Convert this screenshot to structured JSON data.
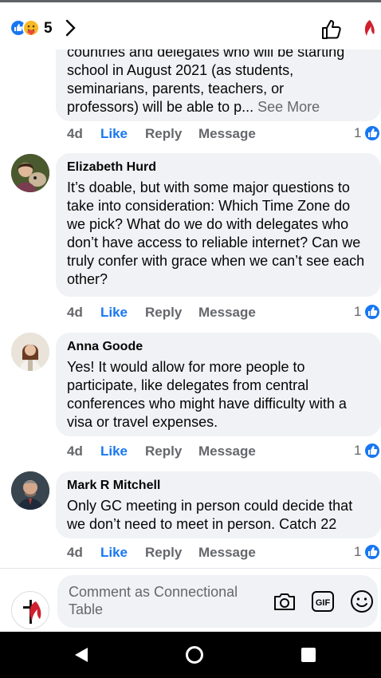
{
  "header": {
    "reaction_count": "5",
    "reaction_icons": [
      "like-icon",
      "care-icon"
    ],
    "chevron": "chevron-right-icon",
    "like_button_icon": "thumbs-up-outline-icon",
    "page_logo": "cross-and-flame-logo"
  },
  "comments": [
    {
      "author": "",
      "text_lines": [
        "countries and delegates who will be starting",
        "school in August 2021 (as students,",
        "seminarians, parents, teachers, or",
        "professors) will be able to p..."
      ],
      "see_more": "See More",
      "time": "4d",
      "like": "Like",
      "reply": "Reply",
      "message": "Message",
      "reactions": "1"
    },
    {
      "author": "Elizabeth Hurd",
      "text": "It’s doable, but with some major questions to take into consideration: Which Time Zone do we pick? What do we do with delegates who don’t have access to reliable internet? Can we truly confer with grace when we can’t see each other?",
      "time": "4d",
      "like": "Like",
      "reply": "Reply",
      "message": "Message",
      "reactions": "1"
    },
    {
      "author": "Anna Goode",
      "text": "Yes! It would allow for more people to participate, like delegates from central conferences who might have difficulty with a visa or travel expenses.",
      "time": "4d",
      "like": "Like",
      "reply": "Reply",
      "message": "Message",
      "reactions": "1"
    },
    {
      "author": "Mark R Mitchell",
      "text": "Only GC meeting in person could decide that we don’t need to meet in person. Catch 22",
      "time": "4d",
      "like": "Like",
      "reply": "Reply",
      "message": "Message",
      "reactions": "1"
    }
  ],
  "composer": {
    "placeholder": "Comment as Connectional Table",
    "icons": [
      "camera-icon",
      "gif-icon",
      "emoji-icon"
    ]
  },
  "navbar": {
    "icons": [
      "back-icon",
      "home-icon",
      "recents-icon"
    ]
  },
  "colors": {
    "accent": "#1877f2",
    "bubble": "#f0f2f5",
    "muted": "#65676b"
  }
}
